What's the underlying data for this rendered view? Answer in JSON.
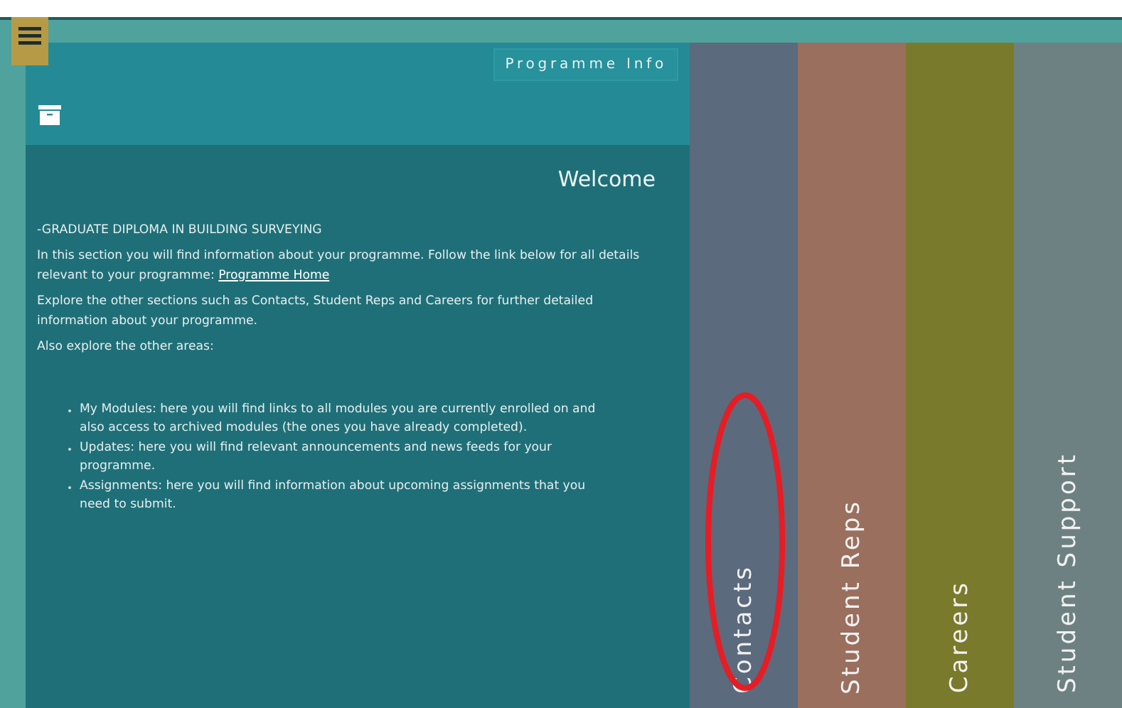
{
  "header": {
    "programme_info_button": "Programme Info"
  },
  "welcome": {
    "title": "Welcome",
    "programme": "-GRADUATE DIPLOMA IN BUILDING SURVEYING",
    "intro": "In this section you will find information about your programme. Follow the link below for all details relevant to your programme: ",
    "intro_link": "Programme Home",
    "explore": "Explore the other sections such as Contacts, Student Reps and Careers for further detailed information about your programme.",
    "also": "Also explore the other areas:",
    "areas": [
      "My Modules: here you will find links to all modules you are currently enrolled on and also access to archived modules (the ones you have already completed).",
      "Updates: here you will find relevant announcements and news feeds for your programme.",
      "Assignments: here you will find information about upcoming assignments that you need to submit."
    ]
  },
  "tiles": [
    {
      "label": "Contacts",
      "color": "#5b6a7c",
      "circled": true
    },
    {
      "label": "Student Reps",
      "color": "#9a6f5e",
      "circled": false
    },
    {
      "label": "Careers",
      "color": "#7a7a2c",
      "circled": false
    },
    {
      "label": "Student Support",
      "color": "#6e8182",
      "circled": false
    }
  ]
}
